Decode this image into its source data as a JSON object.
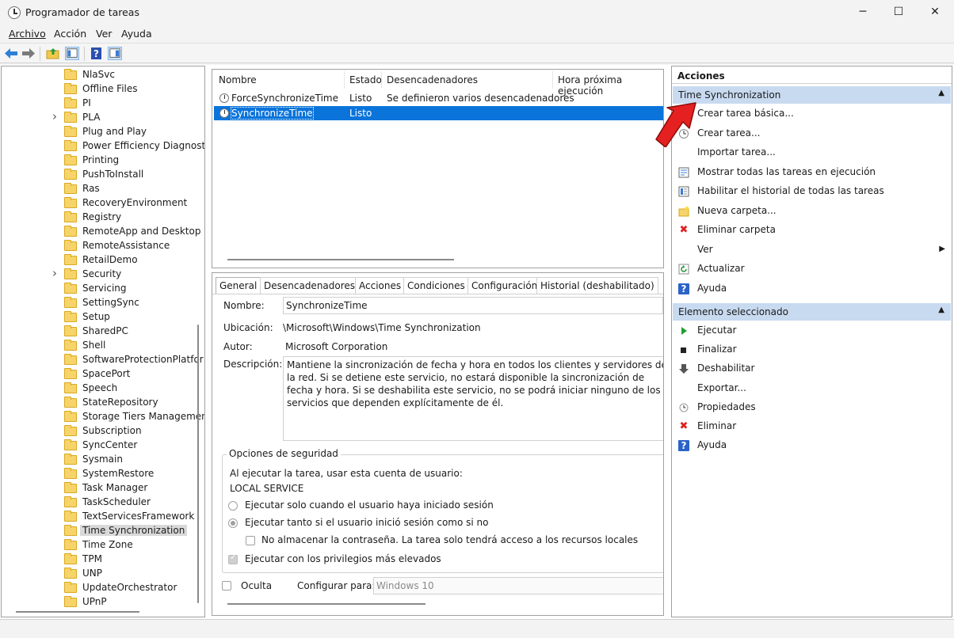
{
  "window": {
    "title": "Programador de tareas",
    "minimize": "─",
    "maximize": "☐",
    "close": "✕"
  },
  "menu": [
    "Archivo",
    "Acción",
    "Ver",
    "Ayuda"
  ],
  "tree": {
    "items": [
      {
        "label": "NlaSvc",
        "expandable": false
      },
      {
        "label": "Offline Files",
        "expandable": false
      },
      {
        "label": "PI",
        "expandable": false
      },
      {
        "label": "PLA",
        "expandable": true
      },
      {
        "label": "Plug and Play",
        "expandable": false
      },
      {
        "label": "Power Efficiency Diagnost",
        "expandable": false
      },
      {
        "label": "Printing",
        "expandable": false
      },
      {
        "label": "PushToInstall",
        "expandable": false
      },
      {
        "label": "Ras",
        "expandable": false
      },
      {
        "label": "RecoveryEnvironment",
        "expandable": false
      },
      {
        "label": "Registry",
        "expandable": false
      },
      {
        "label": "RemoteApp and Desktop C",
        "expandable": false
      },
      {
        "label": "RemoteAssistance",
        "expandable": false
      },
      {
        "label": "RetailDemo",
        "expandable": false
      },
      {
        "label": "Security",
        "expandable": true
      },
      {
        "label": "Servicing",
        "expandable": false
      },
      {
        "label": "SettingSync",
        "expandable": false
      },
      {
        "label": "Setup",
        "expandable": false
      },
      {
        "label": "SharedPC",
        "expandable": false
      },
      {
        "label": "Shell",
        "expandable": false
      },
      {
        "label": "SoftwareProtectionPlatfor",
        "expandable": false
      },
      {
        "label": "SpacePort",
        "expandable": false
      },
      {
        "label": "Speech",
        "expandable": false
      },
      {
        "label": "StateRepository",
        "expandable": false
      },
      {
        "label": "Storage Tiers Managemen",
        "expandable": false
      },
      {
        "label": "Subscription",
        "expandable": false
      },
      {
        "label": "SyncCenter",
        "expandable": false
      },
      {
        "label": "Sysmain",
        "expandable": false
      },
      {
        "label": "SystemRestore",
        "expandable": false
      },
      {
        "label": "Task Manager",
        "expandable": false
      },
      {
        "label": "TaskScheduler",
        "expandable": false
      },
      {
        "label": "TextServicesFramework",
        "expandable": false
      },
      {
        "label": "Time Synchronization",
        "expandable": false,
        "selected": true
      },
      {
        "label": "Time Zone",
        "expandable": false
      },
      {
        "label": "TPM",
        "expandable": false
      },
      {
        "label": "UNP",
        "expandable": false
      },
      {
        "label": "UpdateOrchestrator",
        "expandable": false
      },
      {
        "label": "UPnP",
        "expandable": false
      }
    ]
  },
  "task_list": {
    "columns": [
      "Nombre",
      "Estado",
      "Desencadenadores",
      "Hora próxima ejecución"
    ],
    "rows": [
      {
        "name": "ForceSynchronizeTime",
        "status": "Listo",
        "triggers": "Se definieron varios desencadenadores",
        "selected": false
      },
      {
        "name": "SynchronizeTime",
        "status": "Listo",
        "triggers": "",
        "selected": true
      }
    ]
  },
  "details": {
    "tabs": [
      "General",
      "Desencadenadores",
      "Acciones",
      "Condiciones",
      "Configuración",
      "Historial (deshabilitado)"
    ],
    "active_tab": "General",
    "name_label": "Nombre:",
    "name_value": "SynchronizeTime",
    "location_label": "Ubicación:",
    "location_value": "\\Microsoft\\Windows\\Time Synchronization",
    "author_label": "Autor:",
    "author_value": "Microsoft Corporation",
    "description_label": "Descripción:",
    "description_value": "Mantiene la sincronización de fecha y hora en todos los clientes y servidores de la red. Si se detiene este servicio, no estará disponible la sincronización de fecha y hora. Si se deshabilita este servicio, no se podrá iniciar ninguno de los servicios que dependen explícitamente de él.",
    "security": {
      "title": "Opciones de seguridad",
      "account_prompt": "Al ejecutar la tarea, usar esta cuenta de usuario:",
      "account": "LOCAL SERVICE",
      "radio_logged_on": "Ejecutar solo cuando el usuario haya iniciado sesión",
      "radio_whether": "Ejecutar tanto si el usuario inició sesión como si no",
      "no_store_password": "No almacenar la contraseña. La tarea solo tendrá acceso a los recursos locales",
      "highest_privileges": "Ejecutar con los privilegios más elevados",
      "selected_radio": "whether"
    },
    "hidden_label": "Oculta",
    "configure_label": "Configurar para:",
    "configure_value": "Windows 10"
  },
  "actions": {
    "header": "Acciones",
    "folder_section": {
      "title": "Time Synchronization",
      "items": [
        {
          "label": "Crear tarea básica...",
          "icon": "create-basic-task-icon"
        },
        {
          "label": "Crear tarea...",
          "icon": "create-task-icon"
        },
        {
          "label": "Importar tarea...",
          "icon": ""
        },
        {
          "label": "Mostrar todas las tareas en ejecución",
          "icon": "running-tasks-icon"
        },
        {
          "label": "Habilitar el historial de todas las tareas",
          "icon": "history-icon"
        },
        {
          "label": "Nueva carpeta...",
          "icon": "new-folder-icon"
        },
        {
          "label": "Eliminar carpeta",
          "icon": "delete-icon"
        },
        {
          "label": "Ver",
          "icon": "",
          "submenu": true
        },
        {
          "label": "Actualizar",
          "icon": "refresh-icon"
        },
        {
          "label": "Ayuda",
          "icon": "help-icon"
        }
      ]
    },
    "selected_section": {
      "title": "Elemento seleccionado",
      "items": [
        {
          "label": "Ejecutar",
          "icon": "run-icon"
        },
        {
          "label": "Finalizar",
          "icon": "stop-icon"
        },
        {
          "label": "Deshabilitar",
          "icon": "disable-icon"
        },
        {
          "label": "Exportar...",
          "icon": ""
        },
        {
          "label": "Propiedades",
          "icon": "properties-icon"
        },
        {
          "label": "Eliminar",
          "icon": "delete-icon"
        },
        {
          "label": "Ayuda",
          "icon": "help-icon"
        }
      ]
    }
  },
  "colors": {
    "selection": "#0a74da",
    "section_header": "#c8daf0",
    "folder": "#f7d46a",
    "annotation_arrow": "#e52020"
  }
}
